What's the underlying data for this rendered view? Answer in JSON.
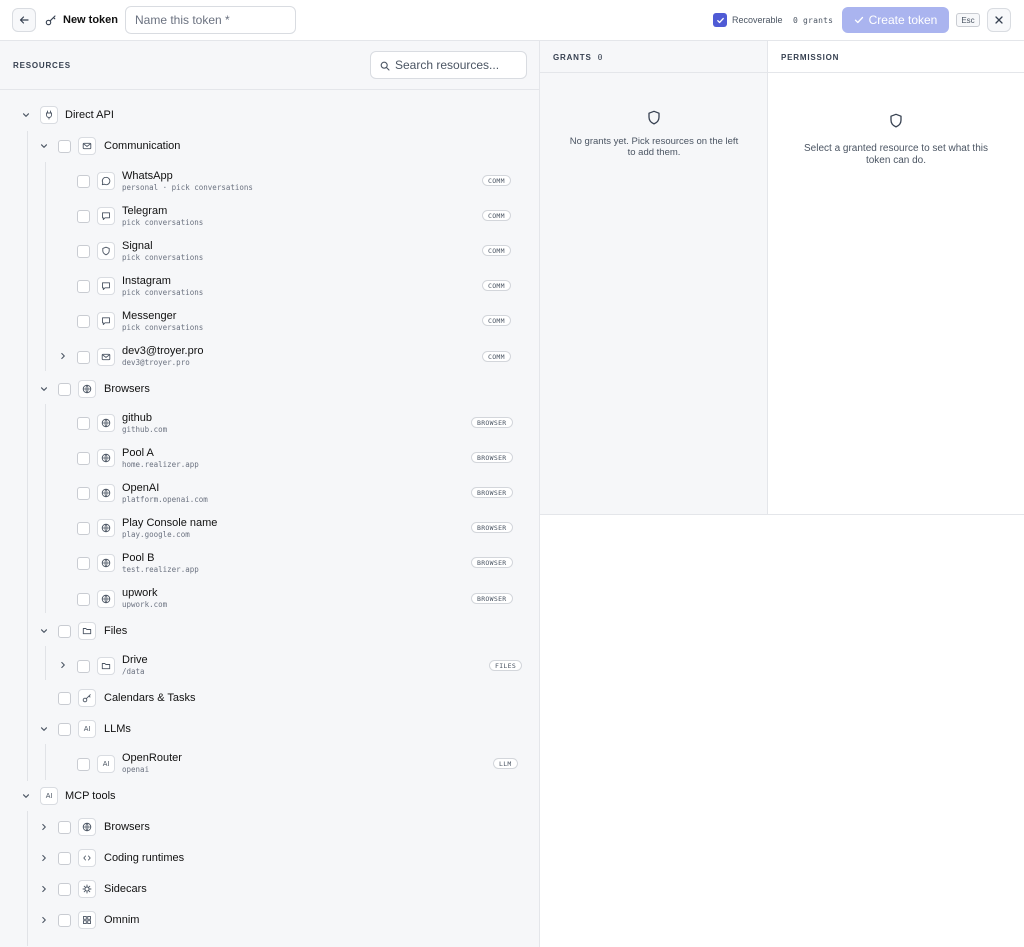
{
  "topbar": {
    "title": "New token",
    "name_placeholder": "Name this token *",
    "recoverable_label": "Recoverable",
    "grants_count": "0 grants",
    "create_label": "Create token",
    "esc_label": "Esc"
  },
  "resources": {
    "heading": "RESOURCES",
    "search_placeholder": "Search resources...",
    "direct_api": "Direct API",
    "communication": "Communication",
    "comm_items": [
      {
        "label": "WhatsApp",
        "sub": "personal · pick conversations",
        "badge": "COMM",
        "icon": "whatsapp-icon"
      },
      {
        "label": "Telegram",
        "sub": "pick conversations",
        "badge": "COMM",
        "icon": "chat-icon"
      },
      {
        "label": "Signal",
        "sub": "pick conversations",
        "badge": "COMM",
        "icon": "shield-icon"
      },
      {
        "label": "Instagram",
        "sub": "pick conversations",
        "badge": "COMM",
        "icon": "chat-icon"
      },
      {
        "label": "Messenger",
        "sub": "pick conversations",
        "badge": "COMM",
        "icon": "chat-icon"
      },
      {
        "label": "dev3@troyer.pro",
        "sub": "dev3@troyer.pro",
        "badge": "COMM",
        "icon": "mail-icon"
      }
    ],
    "browsers": "Browsers",
    "browser_items": [
      {
        "label": "github",
        "sub": "github.com",
        "badge": "BROWSER"
      },
      {
        "label": "Pool A",
        "sub": "home.realizer.app",
        "badge": "BROWSER"
      },
      {
        "label": "OpenAI",
        "sub": "platform.openai.com",
        "badge": "BROWSER"
      },
      {
        "label": "Play Console name",
        "sub": "play.google.com",
        "badge": "BROWSER"
      },
      {
        "label": "Pool B",
        "sub": "test.realizer.app",
        "badge": "BROWSER"
      },
      {
        "label": "upwork",
        "sub": "upwork.com",
        "badge": "BROWSER"
      }
    ],
    "files": "Files",
    "drive": {
      "label": "Drive",
      "sub": "/data",
      "badge": "FILES"
    },
    "calendars": "Calendars & Tasks",
    "llms": "LLMs",
    "llm_icon": "AI",
    "openrouter": {
      "label": "OpenRouter",
      "sub": "openai",
      "badge": "LLM"
    },
    "mcp_tools": "MCP tools",
    "mcp_items": [
      "Browsers",
      "Coding runtimes",
      "Sidecars",
      "Omnim"
    ]
  },
  "grants": {
    "heading": "GRANTS",
    "count": "0",
    "empty_line1": "No grants yet. Pick resources on the left",
    "empty_line2": "to add them."
  },
  "permission": {
    "heading": "PERMISSION",
    "empty_line1": "Select a granted resource to set what this",
    "empty_line2": "token can do."
  },
  "colors": {
    "accent": "#4f5bd5",
    "create_button": "#aab4ef",
    "panel_bg": "#f6f7f9",
    "border": "#e4e6ea"
  }
}
